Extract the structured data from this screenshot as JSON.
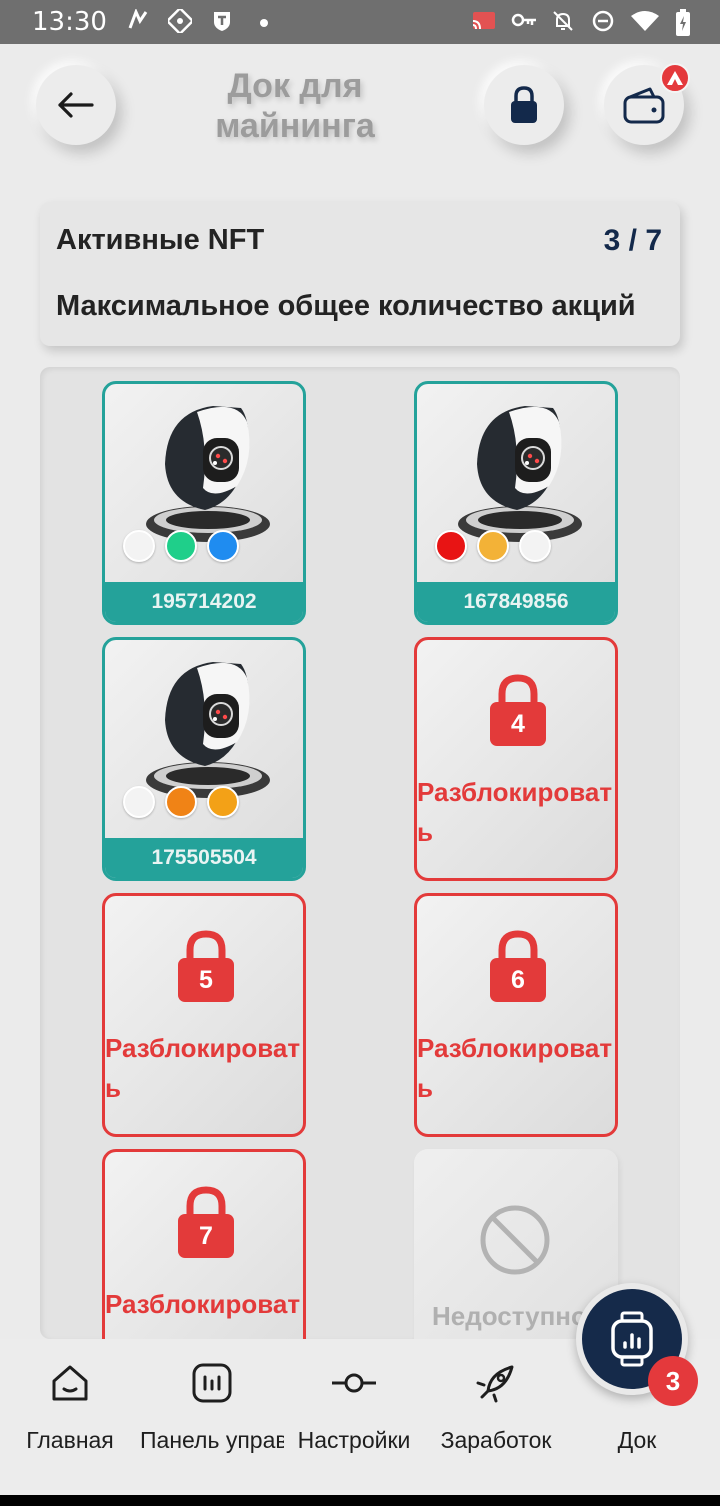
{
  "status_bar": {
    "time": "13:30",
    "left_icons": [
      "n-logo-icon",
      "image-icon",
      "t-shield-icon",
      "dot-icon"
    ],
    "right_icons": [
      "cast-icon",
      "key-icon",
      "bell-off-icon",
      "dnd-icon",
      "wifi-icon",
      "battery-charging-icon"
    ]
  },
  "header": {
    "title": "Док для майнинга",
    "back_icon": "arrow-left-icon",
    "lock_icon": "lock-icon",
    "wallet_icon": "wallet-icon",
    "wallet_badge_icon": "avalanche-icon"
  },
  "info_card": {
    "title": "Активные NFT",
    "count": "3 / 7",
    "subtitle": "Максимальное общее количество акций"
  },
  "slots": [
    {
      "type": "active",
      "id": "195714202",
      "dots": [
        "#f3f3f3",
        "#1fcf8a",
        "#1f8cf0"
      ]
    },
    {
      "type": "active",
      "id": "167849856",
      "dots": [
        "#e81414",
        "#f3b237",
        "#f3f3f3"
      ]
    },
    {
      "type": "active",
      "id": "175505504",
      "dots": [
        "#f3f3f3",
        "#f08316",
        "#f3a117"
      ]
    },
    {
      "type": "locked",
      "number": "4",
      "label": "Разблокировать"
    },
    {
      "type": "locked",
      "number": "5",
      "label": "Разблокировать"
    },
    {
      "type": "locked",
      "number": "6",
      "label": "Разблокировать"
    },
    {
      "type": "locked",
      "number": "7",
      "label": "Разблокировать"
    },
    {
      "type": "unavailable",
      "label": "Недоступно",
      "icon": "block-icon"
    }
  ],
  "bottom_nav": {
    "items": [
      {
        "label": "Главная",
        "icon": "home-icon"
      },
      {
        "label": "Панель управления",
        "icon": "dashboard-icon"
      },
      {
        "label": "Настройки",
        "icon": "settings-icon"
      },
      {
        "label": "Заработок",
        "icon": "rocket-icon"
      },
      {
        "label": "Док",
        "icon": "watch-icon"
      }
    ],
    "fab_badge": "3"
  },
  "colors": {
    "accent_teal": "#24a29a",
    "locked_red": "#e33a3a",
    "navy": "#152a4a",
    "badge_red": "#e4393c"
  }
}
